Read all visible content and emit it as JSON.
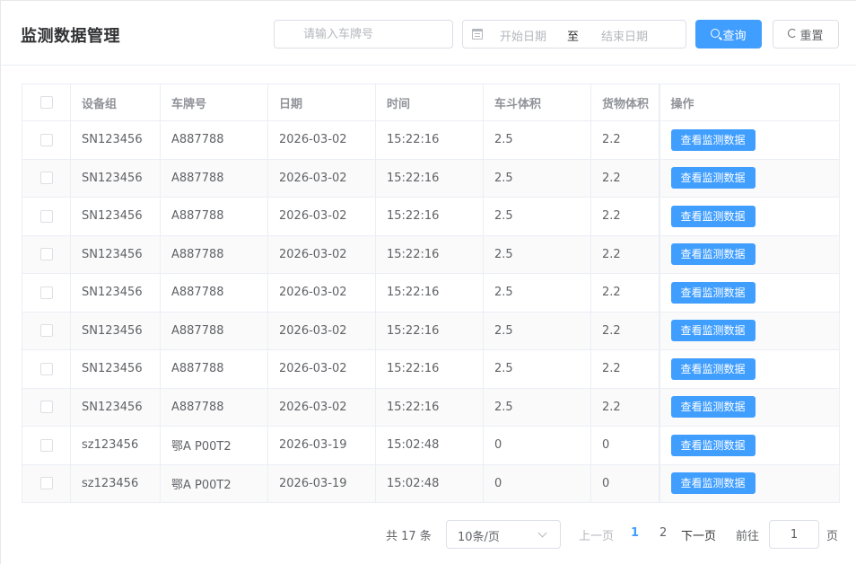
{
  "header": {
    "title": "监测数据管理",
    "plate_placeholder": "请输入车牌号",
    "date_start_placeholder": "开始日期",
    "date_separator": "至",
    "date_end_placeholder": "结束日期",
    "query_label": "查询",
    "reset_label": "重置"
  },
  "table": {
    "columns": [
      "设备组",
      "车牌号",
      "日期",
      "时间",
      "车斗体积",
      "货物体积",
      "操作"
    ],
    "rows": [
      {
        "device": "SN123456",
        "plate": "A887788",
        "date": "2026-03-02",
        "time": "15:22:16",
        "bucket": "2.5",
        "cargo": "2.2",
        "action": "查看监测数据"
      },
      {
        "device": "SN123456",
        "plate": "A887788",
        "date": "2026-03-02",
        "time": "15:22:16",
        "bucket": "2.5",
        "cargo": "2.2",
        "action": "查看监测数据"
      },
      {
        "device": "SN123456",
        "plate": "A887788",
        "date": "2026-03-02",
        "time": "15:22:16",
        "bucket": "2.5",
        "cargo": "2.2",
        "action": "查看监测数据"
      },
      {
        "device": "SN123456",
        "plate": "A887788",
        "date": "2026-03-02",
        "time": "15:22:16",
        "bucket": "2.5",
        "cargo": "2.2",
        "action": "查看监测数据"
      },
      {
        "device": "SN123456",
        "plate": "A887788",
        "date": "2026-03-02",
        "time": "15:22:16",
        "bucket": "2.5",
        "cargo": "2.2",
        "action": "查看监测数据"
      },
      {
        "device": "SN123456",
        "plate": "A887788",
        "date": "2026-03-02",
        "time": "15:22:16",
        "bucket": "2.5",
        "cargo": "2.2",
        "action": "查看监测数据"
      },
      {
        "device": "SN123456",
        "plate": "A887788",
        "date": "2026-03-02",
        "time": "15:22:16",
        "bucket": "2.5",
        "cargo": "2.2",
        "action": "查看监测数据"
      },
      {
        "device": "SN123456",
        "plate": "A887788",
        "date": "2026-03-02",
        "time": "15:22:16",
        "bucket": "2.5",
        "cargo": "2.2",
        "action": "查看监测数据"
      },
      {
        "device": "sz123456",
        "plate": "鄂A P00T2",
        "date": "2026-03-19",
        "time": "15:02:48",
        "bucket": "0",
        "cargo": "0",
        "action": "查看监测数据"
      },
      {
        "device": "sz123456",
        "plate": "鄂A P00T2",
        "date": "2026-03-19",
        "time": "15:02:48",
        "bucket": "0",
        "cargo": "0",
        "action": "查看监测数据"
      }
    ]
  },
  "pager": {
    "total": "共 17 条",
    "page_size": "10条/页",
    "prev": "上一页",
    "pages": [
      "1",
      "2"
    ],
    "next": "下一页",
    "goto_label": "前往",
    "goto_value": "1",
    "page_unit": "页"
  },
  "colors": {
    "primary": "#409eff",
    "border": "#dcdfe6",
    "header_text": "#909399",
    "body_text": "#606266"
  },
  "icons": {
    "query": "search-icon",
    "reset": "refresh-icon",
    "date": "calendar-icon",
    "select": "chevron-down-icon"
  }
}
